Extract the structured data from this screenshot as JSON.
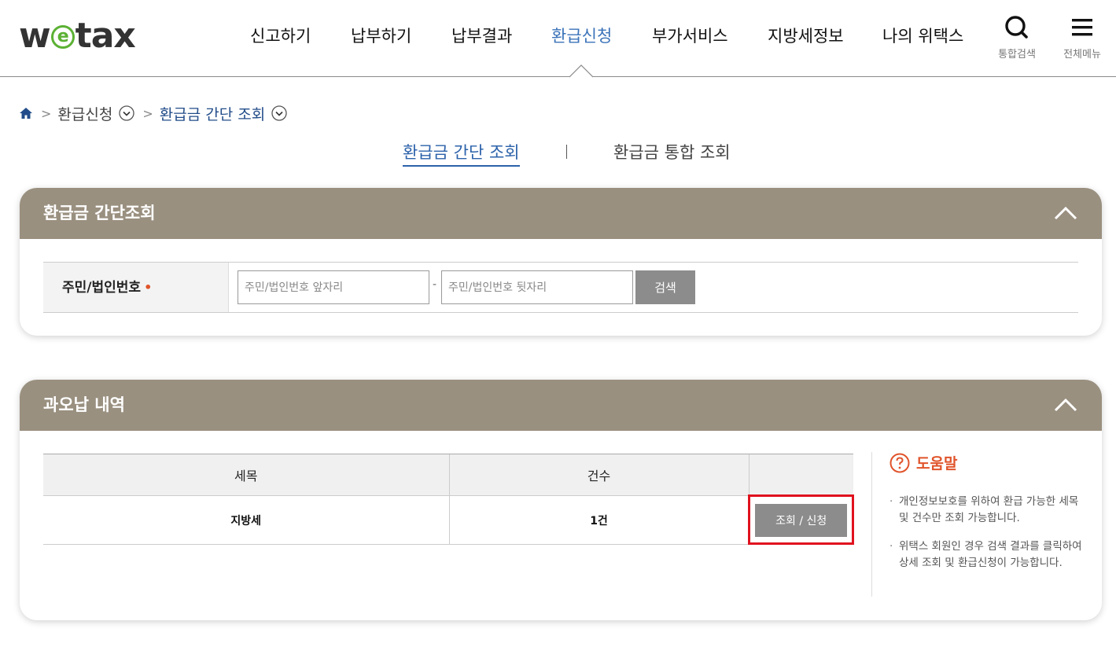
{
  "brand": {
    "logo_pre": "w",
    "logo_e": "e",
    "logo_post": "tax"
  },
  "gnb": [
    {
      "label": "신고하기"
    },
    {
      "label": "납부하기"
    },
    {
      "label": "납부결과"
    },
    {
      "label": "환급신청"
    },
    {
      "label": "부가서비스"
    },
    {
      "label": "지방세정보"
    },
    {
      "label": "나의 위택스"
    }
  ],
  "active_menu": "환급신청",
  "util": {
    "search_label": "통합검색",
    "menu_label": "전체메뉴",
    "search_icon": "search-icon",
    "menu_icon": "hamburger-icon"
  },
  "breadcrumb": {
    "home_icon": "home-icon",
    "level1": "환급신청",
    "current": "환급금 간단 조회"
  },
  "subtabs": [
    {
      "label": "환급금 간단 조회",
      "active": true
    },
    {
      "label": "환급금 통합 조회",
      "active": false
    }
  ],
  "search_panel": {
    "title": "환급금 간단조회",
    "field_label": "주민/법인번호",
    "required_mark": "•",
    "front_placeholder": "주민/법인번호 앞자리",
    "back_placeholder": "주민/법인번호 뒷자리",
    "separator": "-",
    "search_button": "검색"
  },
  "overpay_panel": {
    "title": "과오납 내역",
    "columns": [
      "세목",
      "건수",
      ""
    ],
    "rows": [
      {
        "tax_item": "지방세",
        "count": "1건",
        "action": "조회 / 신청"
      }
    ]
  },
  "help": {
    "title": "도움말",
    "items": [
      "개인정보보호를 위하여 환급 가능한 세목 및 건수만 조회 가능합니다.",
      "위택스 회원인 경우 검색 결과를 클릭하여 상세 조회 및 환급신청이 가능합니다."
    ]
  },
  "colors": {
    "panel_header": "#9a9080",
    "active_link": "#2c62aa",
    "accent_orange": "#e0542b",
    "highlight_border": "#e0121e",
    "button_gray": "#8c8c8c"
  }
}
